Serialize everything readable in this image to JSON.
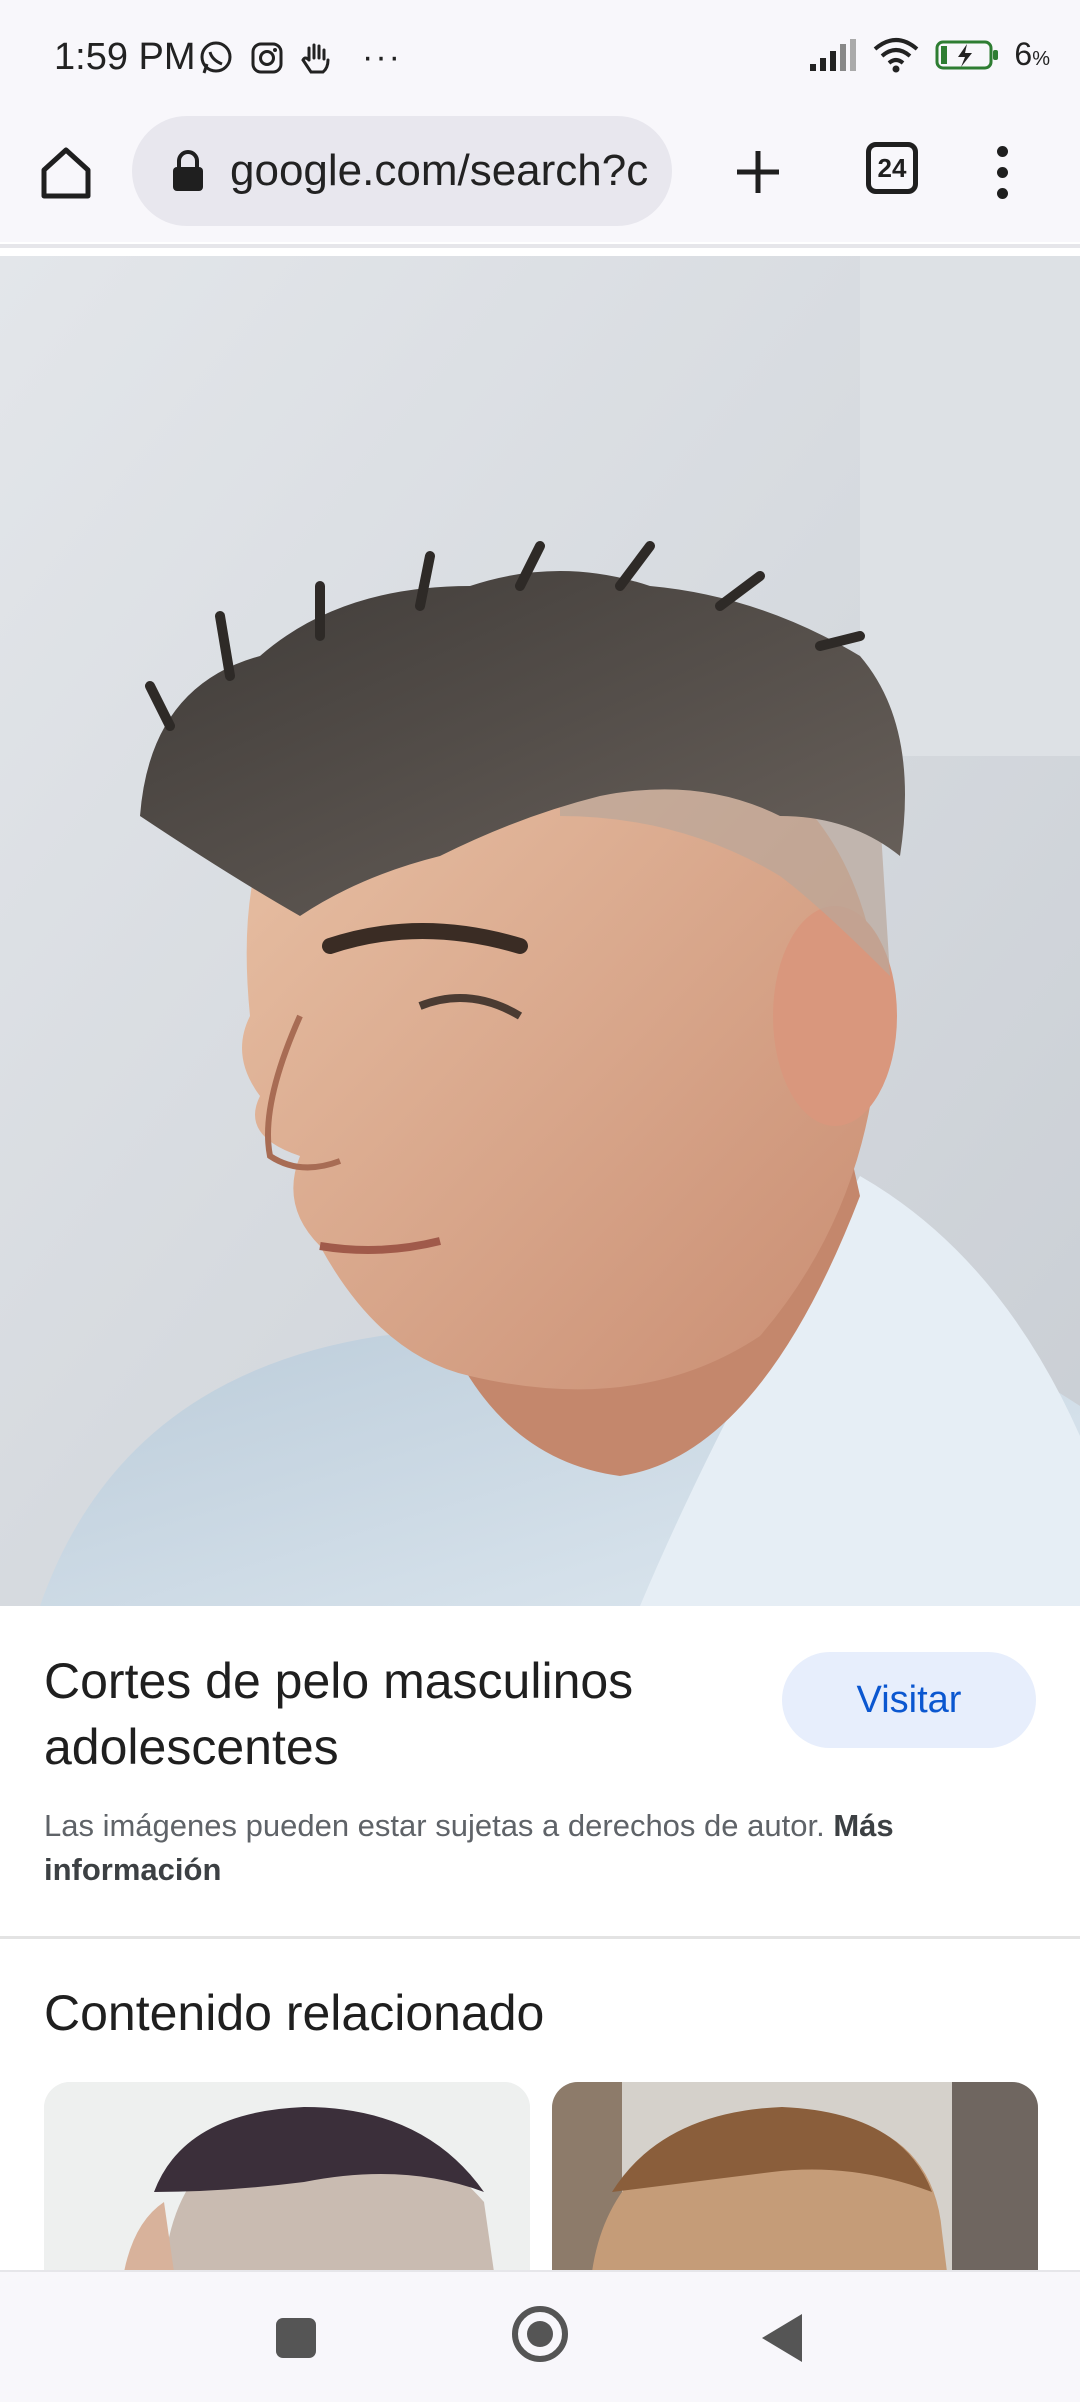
{
  "status_bar": {
    "time": "1:59 PM",
    "app_icons": [
      "whatsapp-icon",
      "instagram-icon",
      "hand-icon",
      "more-dots"
    ],
    "more_dots": "···",
    "battery_percent": "6",
    "battery_unit": "%"
  },
  "toolbar": {
    "url": "google.com/search?c",
    "tab_count": "24"
  },
  "result": {
    "title": "Cortes de pelo masculinos adolescentes",
    "visit_label": "Visitar",
    "copyright_text": "Las imágenes pueden estar sujetas a derechos de autor.",
    "more_info_link": "Más información"
  },
  "related": {
    "heading": "Contenido relacionado"
  },
  "colors": {
    "accent": "#0b57d0",
    "visit_bg": "#e7eefc",
    "chrome_bg": "#f8f7fb"
  }
}
